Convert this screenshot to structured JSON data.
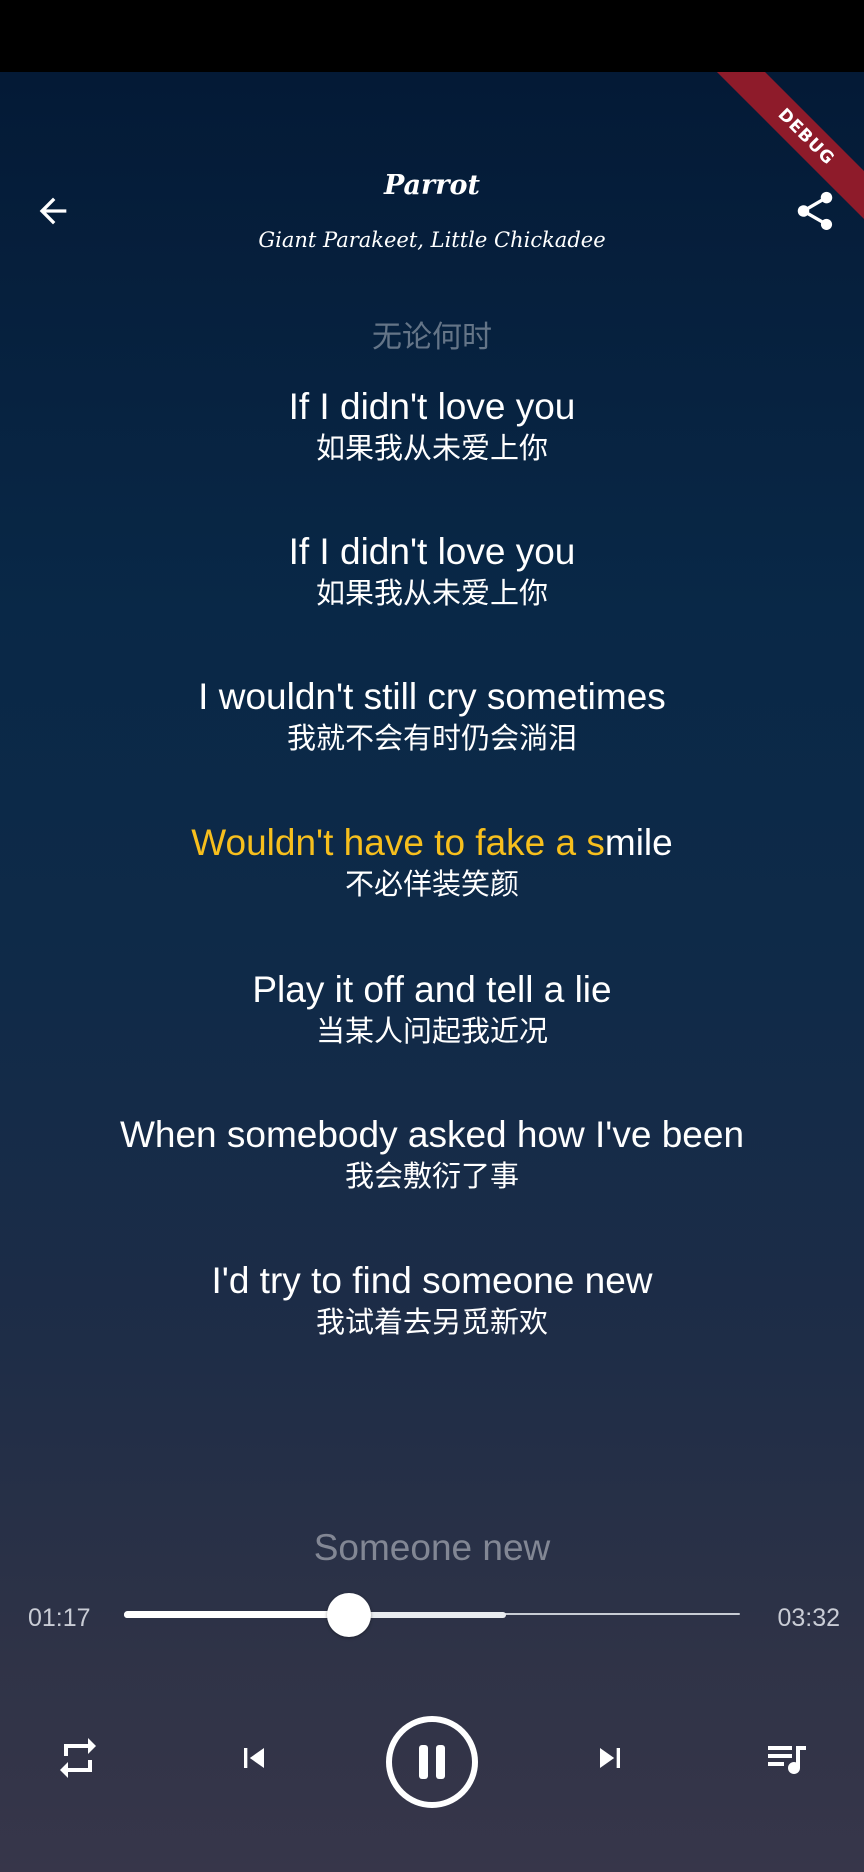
{
  "header": {
    "title": "Parrot",
    "artist": "Giant Parakeet, Little Chickadee",
    "back_icon": "arrow-left-icon",
    "share_icon": "share-icon"
  },
  "debug_banner": "DEBUG",
  "lyrics": {
    "previous": "无论何时",
    "lines": [
      {
        "en": "If I didn't love you",
        "zh": "如果我从未爱上你"
      },
      {
        "en": "If I didn't love you",
        "zh": "如果我从未爱上你"
      },
      {
        "en": "I wouldn't still cry sometimes",
        "zh": "我就不会有时仍会淌泪"
      },
      {
        "en_sung": "Wouldn't have to fake a s",
        "en_rest": "mile",
        "zh": "不必佯装笑颜"
      },
      {
        "en": "Play it off and tell a lie",
        "zh": "当某人问起我近况"
      },
      {
        "en": "When somebody asked how I've been",
        "zh": "我会敷衍了事"
      },
      {
        "en": "I'd try to find someone new",
        "zh": "我试着去另觅新欢"
      }
    ],
    "next": "Someone new",
    "active_color": "#f7bf1d"
  },
  "player": {
    "current_time": "01:17",
    "total_time": "03:32",
    "progress": 0.366,
    "buffered": 0.62,
    "controls": {
      "repeat_icon": "repeat-icon",
      "previous_icon": "skip-previous-icon",
      "pause_icon": "pause-icon",
      "next_icon": "skip-next-icon",
      "playlist_icon": "playlist-icon"
    }
  }
}
